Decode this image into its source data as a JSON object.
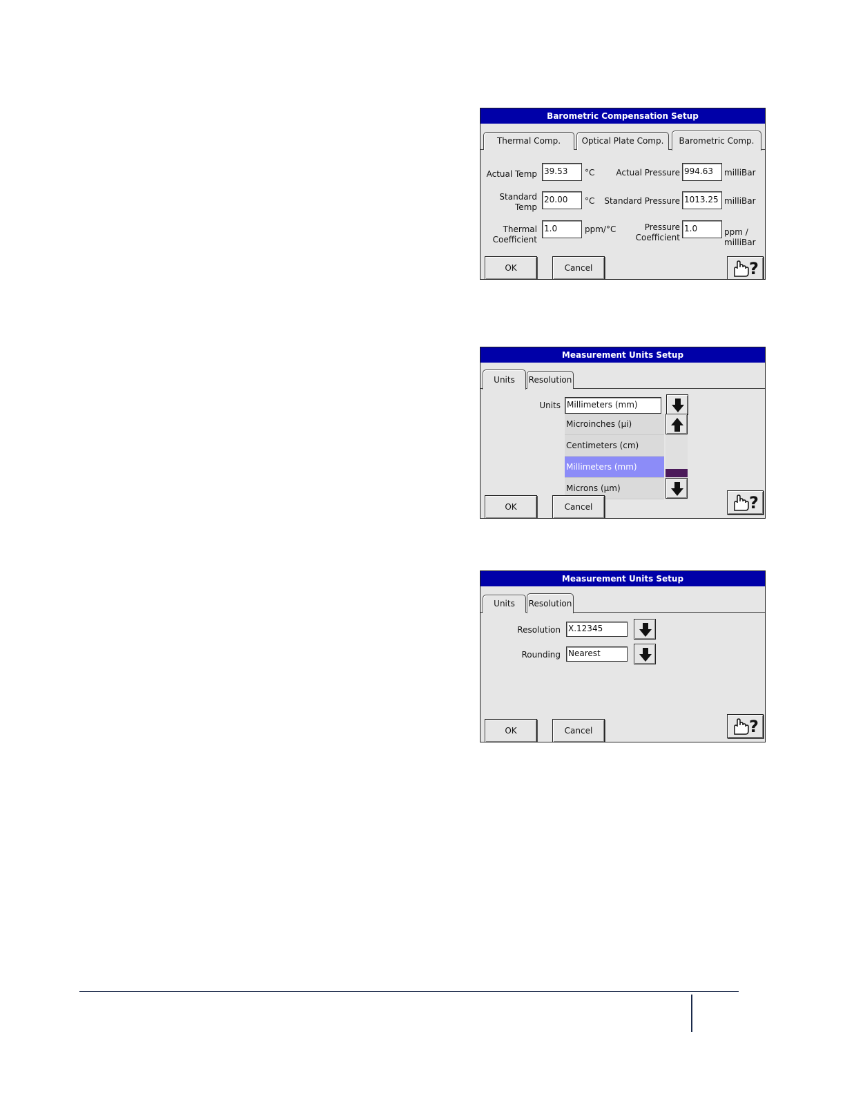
{
  "dialog1": {
    "title": "Barometric Compensation Setup",
    "tabs": [
      "Thermal Comp.",
      "Optical Plate Comp.",
      "Barometric Comp."
    ],
    "active_tab": "Barometric Comp.",
    "actual_temp": {
      "label": "Actual Temp",
      "value": "39.53",
      "unit": "°C"
    },
    "standard_temp": {
      "label_line1": "Standard",
      "label_line2": "Temp",
      "value": "20.00",
      "unit": "°C"
    },
    "thermal_coeff": {
      "label_line1": "Thermal",
      "label_line2": "Coefficient",
      "value": "1.0",
      "unit": "ppm/°C"
    },
    "actual_pressure": {
      "label": "Actual Pressure",
      "value": "994.63",
      "unit": "milliBar"
    },
    "standard_pressure": {
      "label": "Standard Pressure",
      "value": "1013.25",
      "unit": "milliBar"
    },
    "pressure_coeff": {
      "label_line1": "Pressure",
      "label_line2": "Coefficient",
      "value": "1.0",
      "unit_line1": "ppm /",
      "unit_line2": "milliBar"
    },
    "ok_label": "OK",
    "cancel_label": "Cancel"
  },
  "dialog2": {
    "title": "Measurement Units Setup",
    "tabs": [
      "Units",
      "Resolution"
    ],
    "active_tab": "Units",
    "units_label": "Units",
    "units_value": "Millimeters (mm)",
    "dropdown_options": [
      "Microinches (µi)",
      "Centimeters (cm)",
      "Millimeters (mm)",
      "Microns (µm)"
    ],
    "selected_option": "Millimeters (mm)",
    "ok_label": "OK",
    "cancel_label": "Cancel"
  },
  "dialog3": {
    "title": "Measurement Units Setup",
    "tabs": [
      "Units",
      "Resolution"
    ],
    "active_tab": "Resolution",
    "resolution_label": "Resolution",
    "resolution_value": "X.12345",
    "rounding_label": "Rounding",
    "rounding_value": "Nearest",
    "ok_label": "OK",
    "cancel_label": "Cancel"
  },
  "colors": {
    "title_bar": "#0000a8",
    "dialog_bg": "#e6e6e6",
    "selected_item": "#8c8cf8",
    "scroll_thumb": "#4b1a5a"
  },
  "icons": [
    "hand-help-icon",
    "arrow-down-icon",
    "arrow-up-icon"
  ]
}
